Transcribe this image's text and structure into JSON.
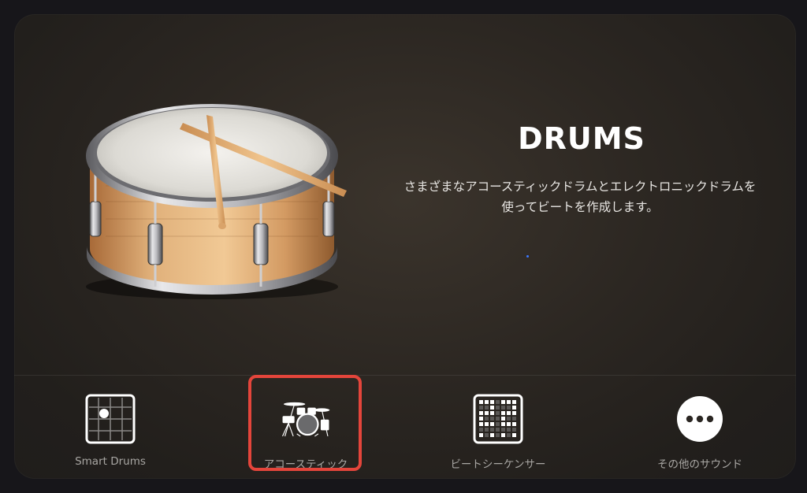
{
  "instrument": {
    "title": "DRUMS",
    "description": "さまざまなアコースティックドラムとエレクトロニックドラムを使ってビートを作成します。",
    "image_icon": "snare-drum-with-sticks"
  },
  "tabs": [
    {
      "label": "Smart Drums",
      "icon": "smart-drums-grid-icon",
      "selected": false
    },
    {
      "label": "アコースティック",
      "icon": "drum-kit-icon",
      "selected": true
    },
    {
      "label": "ビートシーケンサー",
      "icon": "beat-sequencer-icon",
      "selected": false
    },
    {
      "label": "その他のサウンド",
      "icon": "more-ellipsis-icon",
      "selected": false
    }
  ],
  "colors": {
    "background": "#17161a",
    "panel": "#2c2722",
    "title": "#ffffff",
    "tab_label": "#a9a7a4",
    "selection_highlight": "#e4453b",
    "page_indicator": "#3a78ff"
  }
}
